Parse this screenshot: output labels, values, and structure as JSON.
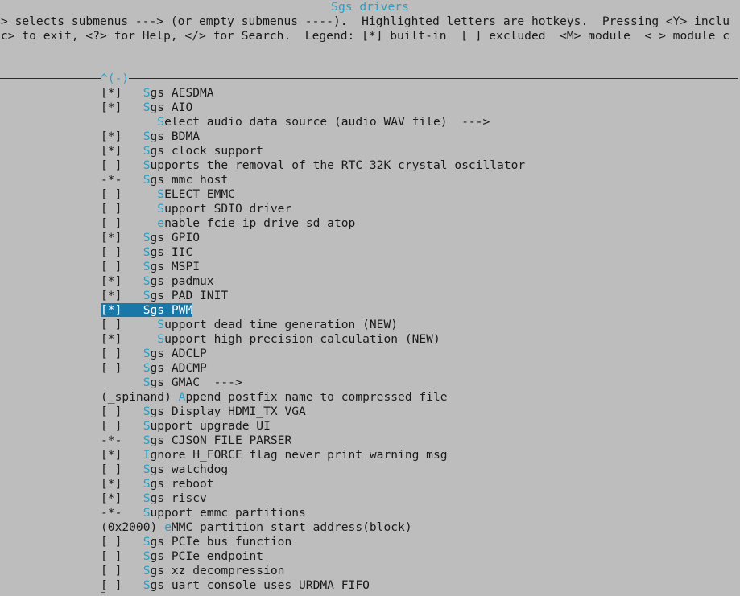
{
  "window": {
    "title": "Sgs drivers"
  },
  "help": {
    "line1": "> selects submenus ---> (or empty submenus ----).  Highlighted letters are hotkeys.  Pressing <Y> inclu",
    "line2": "c> to exit, <?> for Help, </> for Search.  Legend: [*] built-in  [ ] excluded  <M> module  < > module c"
  },
  "menu": {
    "scroll_up_indicator": "^(-)",
    "selected_index": 15,
    "items": [
      {
        "prefix": "[*]   ",
        "hotkey": "S",
        "rest": "gs AESDMA"
      },
      {
        "prefix": "[*]   ",
        "hotkey": "S",
        "rest": "gs AIO"
      },
      {
        "prefix": "        ",
        "hotkey": "S",
        "rest": "elect audio data source (audio WAV file)  --->"
      },
      {
        "prefix": "[*]   ",
        "hotkey": "S",
        "rest": "gs BDMA"
      },
      {
        "prefix": "[*]   ",
        "hotkey": "S",
        "rest": "gs clock support"
      },
      {
        "prefix": "[ ]   ",
        "hotkey": "S",
        "rest": "upports the removal of the RTC 32K crystal oscillator"
      },
      {
        "prefix": "-*-   ",
        "hotkey": "S",
        "rest": "gs mmc host"
      },
      {
        "prefix": "[ ]     ",
        "hotkey": "S",
        "rest": "ELECT EMMC"
      },
      {
        "prefix": "[ ]     ",
        "hotkey": "S",
        "rest": "upport SDIO driver"
      },
      {
        "prefix": "[ ]     ",
        "hotkey": "e",
        "rest": "nable fcie ip drive sd atop"
      },
      {
        "prefix": "[*]   ",
        "hotkey": "S",
        "rest": "gs GPIO"
      },
      {
        "prefix": "[ ]   ",
        "hotkey": "S",
        "rest": "gs IIC"
      },
      {
        "prefix": "[ ]   ",
        "hotkey": "S",
        "rest": "gs MSPI"
      },
      {
        "prefix": "[*]   ",
        "hotkey": "S",
        "rest": "gs padmux"
      },
      {
        "prefix": "[*]   ",
        "hotkey": "S",
        "rest": "gs PAD_INIT"
      },
      {
        "prefix": "[*]   ",
        "hotkey": "S",
        "rest": "gs PWM"
      },
      {
        "prefix": "[ ]     ",
        "hotkey": "S",
        "rest": "upport dead time generation (NEW)"
      },
      {
        "prefix": "[*]     ",
        "hotkey": "S",
        "rest": "upport high precision calculation (NEW)"
      },
      {
        "prefix": "[ ]   ",
        "hotkey": "S",
        "rest": "gs ADCLP"
      },
      {
        "prefix": "[ ]   ",
        "hotkey": "S",
        "rest": "gs ADCMP"
      },
      {
        "prefix": "      ",
        "hotkey": "S",
        "rest": "gs GMAC  --->"
      },
      {
        "prefix": "(_spinand) ",
        "hotkey": "A",
        "rest": "ppend postfix name to compressed file"
      },
      {
        "prefix": "[ ]   ",
        "hotkey": "S",
        "rest": "gs Display HDMI_TX VGA"
      },
      {
        "prefix": "[ ]   ",
        "hotkey": "S",
        "rest": "upport upgrade UI"
      },
      {
        "prefix": "-*-   ",
        "hotkey": "S",
        "rest": "gs CJSON FILE PARSER"
      },
      {
        "prefix": "[*]   ",
        "hotkey": "I",
        "rest": "gnore H_FORCE flag never print warning msg"
      },
      {
        "prefix": "[ ]   ",
        "hotkey": "S",
        "rest": "gs watchdog"
      },
      {
        "prefix": "[*]   ",
        "hotkey": "S",
        "rest": "gs reboot"
      },
      {
        "prefix": "[*]   ",
        "hotkey": "S",
        "rest": "gs riscv"
      },
      {
        "prefix": "-*-   ",
        "hotkey": "S",
        "rest": "upport emmc partitions"
      },
      {
        "prefix": "(0x2000) ",
        "hotkey": "e",
        "rest": "MMC partition start address(block)"
      },
      {
        "prefix": "[ ]   ",
        "hotkey": "S",
        "rest": "gs PCIe bus function"
      },
      {
        "prefix": "[ ]   ",
        "hotkey": "S",
        "rest": "gs PCIe endpoint"
      },
      {
        "prefix": "[ ]   ",
        "hotkey": "S",
        "rest": "gs xz decompression"
      },
      {
        "prefix": "[ ]   ",
        "hotkey": "S",
        "rest": "gs uart console uses URDMA FIFO"
      }
    ]
  }
}
